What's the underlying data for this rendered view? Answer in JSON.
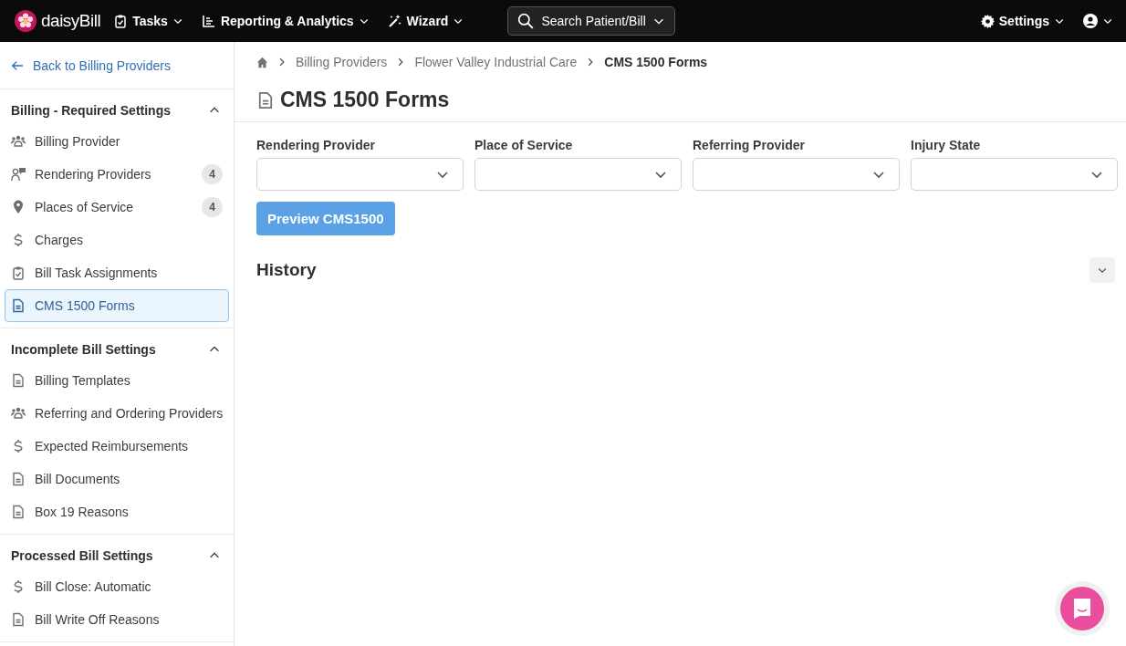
{
  "topbar": {
    "logo": "daisyBill",
    "menus": [
      {
        "label": "Tasks",
        "kind": "clipboard"
      },
      {
        "label": "Reporting & Analytics",
        "kind": "chart"
      },
      {
        "label": "Wizard",
        "kind": "wand"
      }
    ],
    "search": {
      "placeholder": "Search Patient/Bill"
    },
    "settings": {
      "label": "Settings"
    }
  },
  "sidebar": {
    "back": "Back to Billing Providers",
    "sections": [
      {
        "title": "Billing - Required Settings",
        "expanded": true,
        "items": [
          {
            "label": "Billing Provider",
            "kind": "people",
            "selected": false
          },
          {
            "label": "Rendering Providers",
            "kind": "person-chat",
            "badge": "4",
            "selected": false
          },
          {
            "label": "Places of Service",
            "kind": "pin",
            "badge": "4",
            "selected": false
          },
          {
            "label": "Charges",
            "kind": "dollar",
            "selected": false
          },
          {
            "label": "Bill Task Assignments",
            "kind": "clipboard",
            "selected": false
          },
          {
            "label": "CMS 1500 Forms",
            "kind": "doc",
            "selected": true
          }
        ]
      },
      {
        "title": "Incomplete Bill Settings",
        "expanded": true,
        "items": [
          {
            "label": "Billing Templates",
            "kind": "doc",
            "selected": false
          },
          {
            "label": "Referring and Ordering Providers",
            "kind": "people",
            "selected": false
          },
          {
            "label": "Expected Reimbursements",
            "kind": "dollar",
            "selected": false
          },
          {
            "label": "Bill Documents",
            "kind": "doc",
            "selected": false
          },
          {
            "label": "Box 19 Reasons",
            "kind": "doc",
            "selected": false
          }
        ]
      },
      {
        "title": "Processed Bill Settings",
        "expanded": true,
        "items": [
          {
            "label": "Bill Close: Automatic",
            "kind": "dollar",
            "selected": false
          },
          {
            "label": "Bill Write Off Reasons",
            "kind": "doc",
            "selected": false
          }
        ]
      }
    ]
  },
  "breadcrumbs": [
    "Billing Providers",
    "Flower Valley Industrial Care",
    "CMS 1500 Forms"
  ],
  "page_title": "CMS 1500 Forms",
  "filters": [
    {
      "label": "Rendering Provider"
    },
    {
      "label": "Place of Service"
    },
    {
      "label": "Referring Provider"
    },
    {
      "label": "Injury State"
    }
  ],
  "preview_button": "Preview CMS1500",
  "history": {
    "title": "History",
    "expanded": false
  }
}
